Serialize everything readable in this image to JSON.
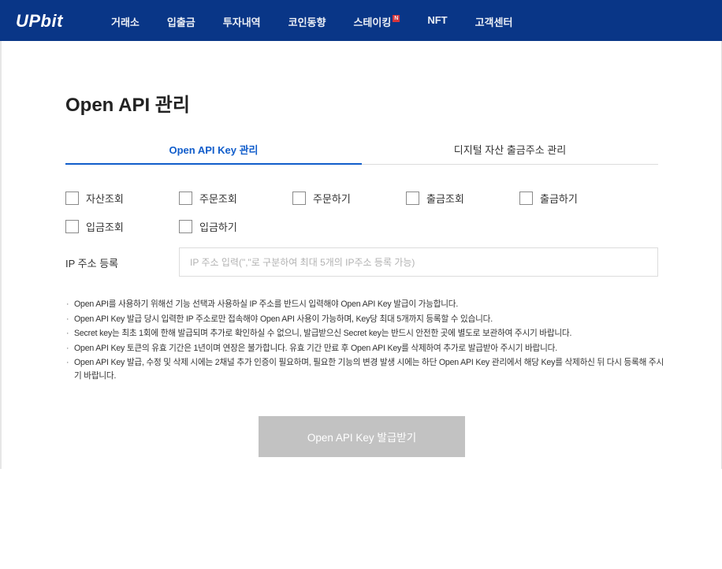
{
  "header": {
    "logo": "UPbit",
    "nav": [
      "거래소",
      "입출금",
      "투자내역",
      "코인동향",
      "스테이킹",
      "NFT",
      "고객센터"
    ],
    "new_badge": "N"
  },
  "page": {
    "title": "Open API 관리"
  },
  "tabs": [
    {
      "label": "Open API Key 관리",
      "active": true
    },
    {
      "label": "디지털 자산 출금주소 관리",
      "active": false
    }
  ],
  "permissions": {
    "row1": [
      "자산조회",
      "주문조회",
      "주문하기",
      "출금조회",
      "출금하기"
    ],
    "row2": [
      "입금조회",
      "입금하기"
    ]
  },
  "ip": {
    "label": "IP 주소 등록",
    "placeholder": "IP 주소 입력(\",\"로 구분하여 최대 5개의 IP주소 등록 가능)",
    "value": ""
  },
  "notes": [
    "Open API를 사용하기 위해선 기능 선택과 사용하실 IP 주소를 반드시 입력해야 Open API Key 발급이 가능합니다.",
    "Open API Key 발급 당시 입력한 IP 주소로만 접속해야 Open API 사용이 가능하며, Key당 최대 5개까지 등록할 수 있습니다.",
    "Secret key는 최초 1회에 한해 발급되며 추가로 확인하실 수 없으니, 발급받으신 Secret key는 반드시 안전한 곳에 별도로 보관하여 주시기 바랍니다.",
    "Open API Key 토큰의 유효 기간은 1년이며 연장은 불가합니다. 유효 기간 만료 후 Open API Key를 삭제하여 추가로 발급받아 주시기 바랍니다.",
    "Open API Key 발급, 수정 및 삭제 시에는 2채널 추가 인증이 필요하며, 필요한 기능의 변경 발생 시에는 하단 Open API Key 관리에서 해당 Key를 삭제하신 뒤 다시 등록해 주시기 바랍니다."
  ],
  "submit_label": "Open API Key 발급받기",
  "colors": {
    "header_bg": "#093687",
    "accent": "#115dcb",
    "button_disabled": "#c2c2c2"
  }
}
